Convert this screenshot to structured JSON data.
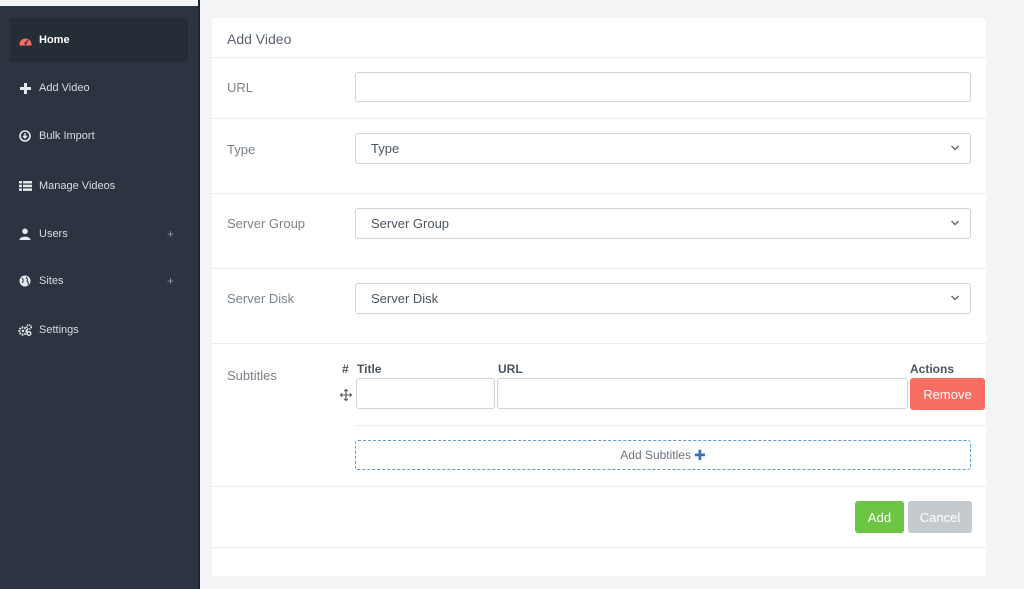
{
  "sidebar": {
    "items": [
      {
        "label": "Home",
        "icon": "dashboard-icon",
        "active": true
      },
      {
        "label": "Add Video",
        "icon": "plus-icon"
      },
      {
        "label": "Bulk Import",
        "icon": "download-circle-icon"
      },
      {
        "label": "Manage Videos",
        "icon": "list-icon"
      },
      {
        "label": "Users",
        "icon": "user-icon",
        "expand": "+"
      },
      {
        "label": "Sites",
        "icon": "globe-icon",
        "expand": "+"
      },
      {
        "label": "Settings",
        "icon": "gears-icon"
      }
    ]
  },
  "form": {
    "title": "Add Video",
    "url_label": "URL",
    "url_value": "",
    "type_label": "Type",
    "type_value": "Type",
    "server_group_label": "Server Group",
    "server_group_value": "Server Group",
    "server_disk_label": "Server Disk",
    "server_disk_value": "Server Disk",
    "subtitles_label": "Subtitles",
    "subtitles_table": {
      "headers": {
        "index": "#",
        "title": "Title",
        "url": "URL",
        "actions": "Actions"
      },
      "rows": [
        {
          "title": "",
          "url": ""
        }
      ],
      "remove_label": "Remove"
    },
    "add_subtitles_label": "Add Subtitles",
    "add_subtitles_plus": "✚",
    "add_button": "Add",
    "cancel_button": "Cancel"
  },
  "colors": {
    "sidebar_bg": "#2b3440",
    "home_icon": "#f96e63",
    "remove": "#f96e63",
    "add": "#6cc644",
    "cancel": "#c5cacf",
    "dashed_border": "#5b9bd5"
  }
}
